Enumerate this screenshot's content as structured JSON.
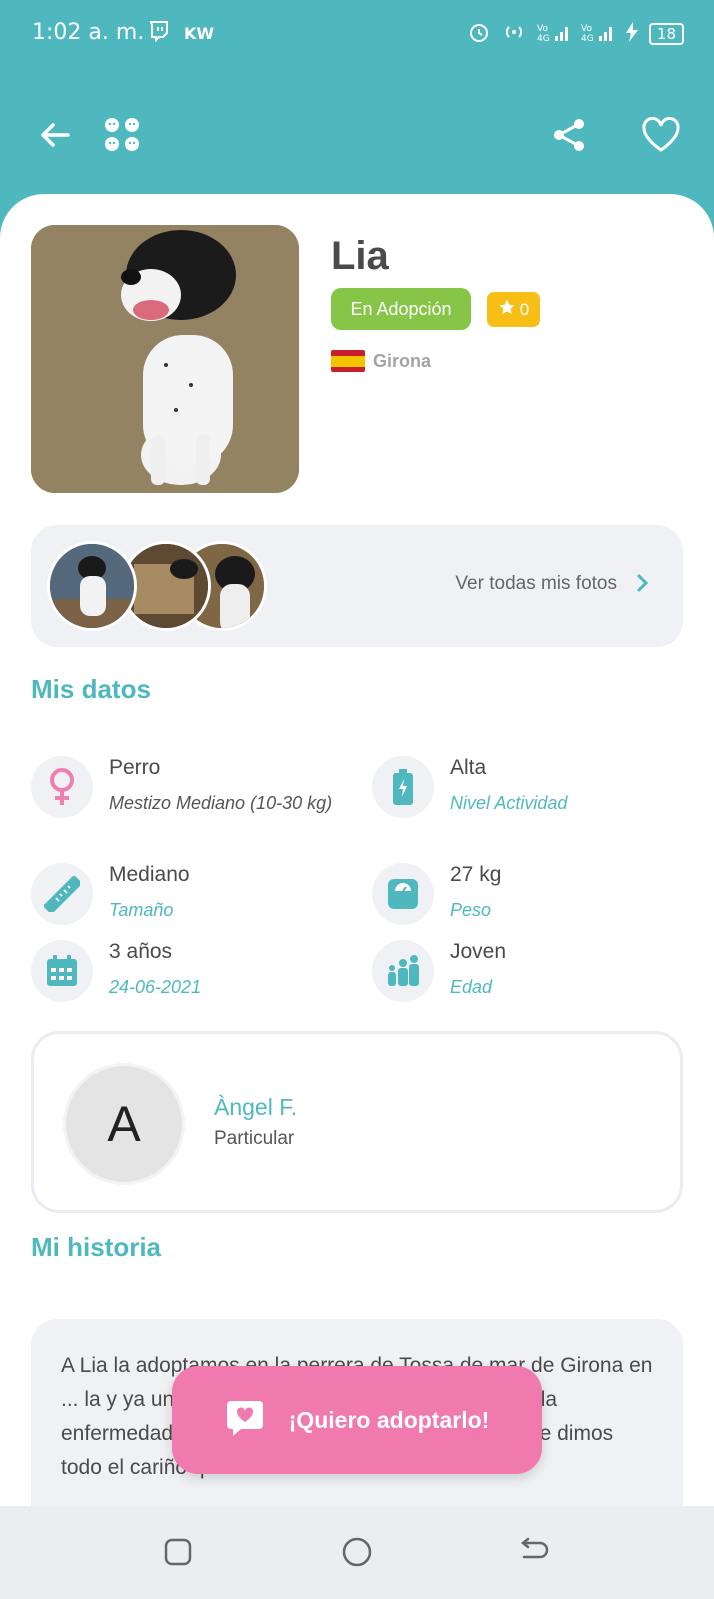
{
  "status_bar": {
    "time": "1:02 a. m.",
    "left_icons": [
      "twitch-icon",
      "kw-icon"
    ],
    "kw_text": "KW",
    "battery": "18",
    "net_labels": [
      "Vo 4G",
      "Vo 4G",
      "4G"
    ]
  },
  "app_bar": {
    "back_icon": "arrow-left-icon",
    "logo_icon": "pets-logo-icon",
    "share_icon": "share-icon",
    "favorite_icon": "heart-outline-icon"
  },
  "pet": {
    "name": "Lia",
    "status": "En Adopción",
    "stars": "0",
    "location": "Girona"
  },
  "photos": {
    "link_label": "Ver todas mis fotos"
  },
  "mis_datos": {
    "title": "Mis datos",
    "items": [
      {
        "value": "Perro",
        "sub": "Mestizo Mediano (10-30 kg)",
        "icon": "female-icon"
      },
      {
        "value": "Alta",
        "sub": "Nivel Actividad",
        "icon": "battery-icon"
      },
      {
        "value": "Mediano",
        "sub": "Tamaño",
        "icon": "ruler-icon"
      },
      {
        "value": "27 kg",
        "sub": "Peso",
        "icon": "scale-icon"
      },
      {
        "value": "3 años",
        "sub": "24-06-2021",
        "icon": "calendar-icon"
      },
      {
        "value": "Joven",
        "sub": "Edad",
        "icon": "family-icon"
      }
    ]
  },
  "owner": {
    "initial": "A",
    "name": "Àngel F.",
    "type": "Particular"
  },
  "historia": {
    "title": "Mi historia",
    "text": "A Lia la adoptamos en la perrera de Tossa de mar de Girona en ... la y ya una carga emo... do y en la perrera cogió la enfermedad de la parvo, se curó completamente y le dimos todo el cariño que"
  },
  "cta": {
    "label": "¡Quiero adoptarlo!"
  },
  "colors": {
    "primary": "#4fb8bf",
    "adopt_green": "#86c548",
    "star_yellow": "#f7bf15",
    "cta_pink": "#f07aad"
  }
}
